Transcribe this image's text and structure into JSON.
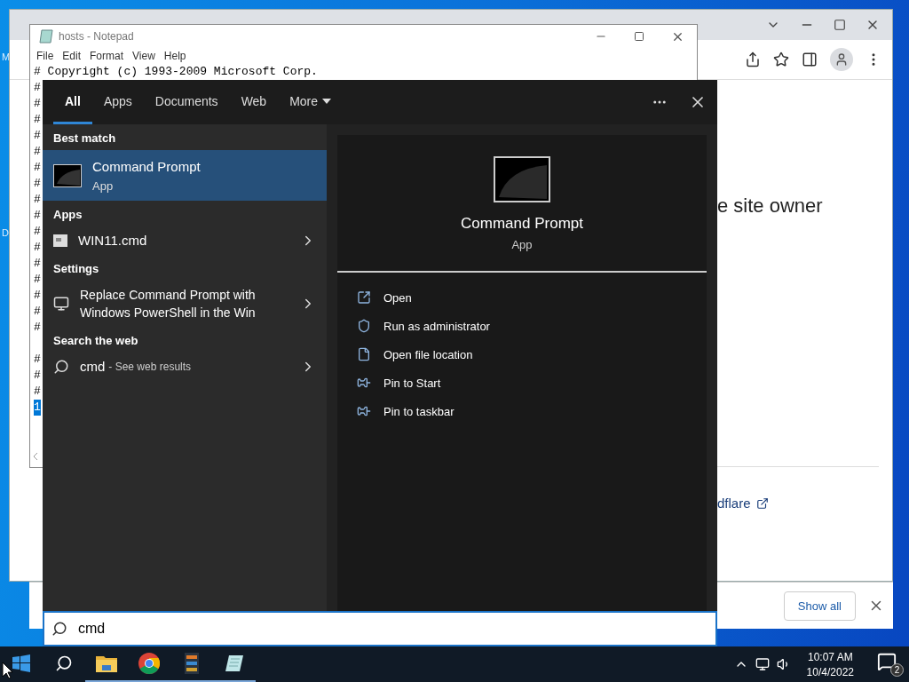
{
  "desktop": {
    "labels": [
      "M",
      "D"
    ]
  },
  "browser": {
    "page_heading": "e site owner",
    "link": "dflare",
    "download_bar": {
      "button": "Show all"
    }
  },
  "notepad": {
    "title": "hosts - Notepad",
    "menu": [
      "File",
      "Edit",
      "Format",
      "View",
      "Help"
    ],
    "blocks": [
      [
        {
          "text": "# Copyright (c) 1993-2009 Microsoft Corp.",
          "selected": false
        },
        {
          "text": "#",
          "selected": false
        },
        {
          "text": "#",
          "selected": false
        },
        {
          "text": "#",
          "selected": false
        },
        {
          "text": "#",
          "selected": false
        },
        {
          "text": "#",
          "selected": false
        },
        {
          "text": "#",
          "selected": false
        },
        {
          "text": "#",
          "selected": false
        },
        {
          "text": "#",
          "selected": false
        },
        {
          "text": "#",
          "selected": false
        },
        {
          "text": "#",
          "selected": false
        },
        {
          "text": "#",
          "selected": false
        },
        {
          "text": "#",
          "selected": false
        },
        {
          "text": "#",
          "selected": false
        },
        {
          "text": "#",
          "selected": false
        },
        {
          "text": "#",
          "selected": false
        },
        {
          "text": "#",
          "selected": false
        }
      ],
      [
        {
          "text": "#",
          "selected": false
        },
        {
          "text": "#",
          "selected": false
        },
        {
          "text": "#",
          "selected": false
        },
        {
          "text": "1",
          "selected": true
        }
      ]
    ]
  },
  "search": {
    "tabs": [
      {
        "label": "All",
        "selected": true,
        "dropdown": false
      },
      {
        "label": "Apps",
        "selected": false,
        "dropdown": false
      },
      {
        "label": "Documents",
        "selected": false,
        "dropdown": false
      },
      {
        "label": "Web",
        "selected": false,
        "dropdown": false
      },
      {
        "label": "More",
        "selected": false,
        "dropdown": true
      }
    ],
    "sections": [
      {
        "heading": "Best match",
        "items": [
          {
            "kind": "best",
            "title": "Command Prompt",
            "subtitle": "App",
            "selected": true
          }
        ]
      },
      {
        "heading": "Apps",
        "items": [
          {
            "kind": "app",
            "title": "WIN11.cmd",
            "selected": false
          }
        ]
      },
      {
        "heading": "Settings",
        "items": [
          {
            "kind": "setting",
            "title": "Replace Command Prompt with Windows PowerShell in the Win",
            "selected": false
          }
        ]
      },
      {
        "heading": "Search the web",
        "items": [
          {
            "kind": "web",
            "title": "cmd",
            "hint": "- See web results",
            "selected": false
          }
        ]
      }
    ],
    "preview": {
      "title": "Command Prompt",
      "subtitle": "App",
      "actions": [
        {
          "kind": "open",
          "label": "Open"
        },
        {
          "kind": "admin",
          "label": "Run as administrator"
        },
        {
          "kind": "location",
          "label": "Open file location"
        },
        {
          "kind": "pin",
          "label": "Pin to Start"
        },
        {
          "kind": "pin",
          "label": "Pin to taskbar"
        }
      ]
    },
    "query": "cmd"
  },
  "taskbar": {
    "apps": [
      {
        "kind": "explorer",
        "running": true
      },
      {
        "kind": "chrome",
        "running": true
      },
      {
        "kind": "terminal",
        "running": true
      },
      {
        "kind": "notepad",
        "running": true
      }
    ],
    "clock": {
      "time": "10:07 AM",
      "date": "10/4/2022"
    },
    "notifications": "2"
  }
}
